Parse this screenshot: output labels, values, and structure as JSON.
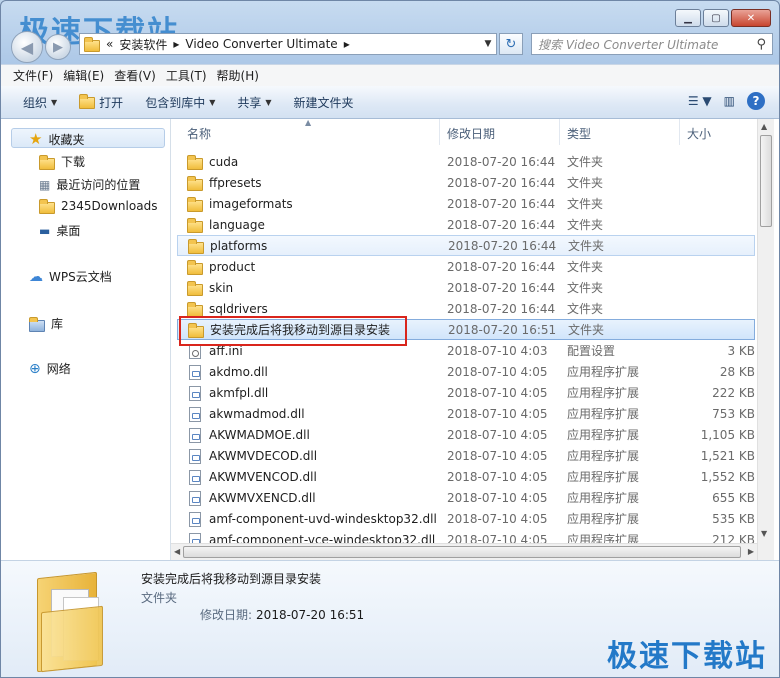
{
  "watermark": "极速下载站",
  "address": {
    "segments": [
      "«",
      "安装软件",
      "Video Converter Ultimate"
    ],
    "sep": "▸"
  },
  "search": {
    "placeholder": "搜索 Video Converter Ultimate"
  },
  "menubar": [
    "文件(F)",
    "编辑(E)",
    "查看(V)",
    "工具(T)",
    "帮助(H)"
  ],
  "toolbar": {
    "organize": "组织",
    "open": "打开",
    "include_library": "包含到库中",
    "share": "共享",
    "new_folder": "新建文件夹"
  },
  "nav": {
    "favorites": "收藏夹",
    "downloads": "下载",
    "recent": "最近访问的位置",
    "d2345": "2345Downloads",
    "desktop": "桌面",
    "wps": "WPS云文档",
    "library": "库",
    "network": "网络"
  },
  "columns": {
    "name": "名称",
    "date": "修改日期",
    "type": "类型",
    "size": "大小"
  },
  "files": [
    {
      "name": "cuda",
      "date": "2018-07-20 16:44",
      "type": "文件夹",
      "size": "",
      "kind": "folder"
    },
    {
      "name": "ffpresets",
      "date": "2018-07-20 16:44",
      "type": "文件夹",
      "size": "",
      "kind": "folder"
    },
    {
      "name": "imageformats",
      "date": "2018-07-20 16:44",
      "type": "文件夹",
      "size": "",
      "kind": "folder"
    },
    {
      "name": "language",
      "date": "2018-07-20 16:44",
      "type": "文件夹",
      "size": "",
      "kind": "folder"
    },
    {
      "name": "platforms",
      "date": "2018-07-20 16:44",
      "type": "文件夹",
      "size": "",
      "kind": "folder",
      "state": "hover"
    },
    {
      "name": "product",
      "date": "2018-07-20 16:44",
      "type": "文件夹",
      "size": "",
      "kind": "folder"
    },
    {
      "name": "skin",
      "date": "2018-07-20 16:44",
      "type": "文件夹",
      "size": "",
      "kind": "folder"
    },
    {
      "name": "sqldrivers",
      "date": "2018-07-20 16:44",
      "type": "文件夹",
      "size": "",
      "kind": "folder"
    },
    {
      "name": "安装完成后将我移动到源目录安装",
      "date": "2018-07-20 16:51",
      "type": "文件夹",
      "size": "",
      "kind": "folder",
      "state": "selected"
    },
    {
      "name": "aff.ini",
      "date": "2018-07-10 4:03",
      "type": "配置设置",
      "size": "3 KB",
      "kind": "ini"
    },
    {
      "name": "akdmo.dll",
      "date": "2018-07-10 4:05",
      "type": "应用程序扩展",
      "size": "28 KB",
      "kind": "dll"
    },
    {
      "name": "akmfpl.dll",
      "date": "2018-07-10 4:05",
      "type": "应用程序扩展",
      "size": "222 KB",
      "kind": "dll"
    },
    {
      "name": "akwmadmod.dll",
      "date": "2018-07-10 4:05",
      "type": "应用程序扩展",
      "size": "753 KB",
      "kind": "dll"
    },
    {
      "name": "AKWMADMOE.dll",
      "date": "2018-07-10 4:05",
      "type": "应用程序扩展",
      "size": "1,105 KB",
      "kind": "dll"
    },
    {
      "name": "AKWMVDECOD.dll",
      "date": "2018-07-10 4:05",
      "type": "应用程序扩展",
      "size": "1,521 KB",
      "kind": "dll"
    },
    {
      "name": "AKWMVENCOD.dll",
      "date": "2018-07-10 4:05",
      "type": "应用程序扩展",
      "size": "1,552 KB",
      "kind": "dll"
    },
    {
      "name": "AKWMVXENCD.dll",
      "date": "2018-07-10 4:05",
      "type": "应用程序扩展",
      "size": "655 KB",
      "kind": "dll"
    },
    {
      "name": "amf-component-uvd-windesktop32.dll",
      "date": "2018-07-10 4:05",
      "type": "应用程序扩展",
      "size": "535 KB",
      "kind": "dll"
    },
    {
      "name": "amf-component-vce-windesktop32.dll",
      "date": "2018-07-10 4:05",
      "type": "应用程序扩展",
      "size": "212 KB",
      "kind": "dll"
    }
  ],
  "details": {
    "name": "安装完成后将我移动到源目录安装",
    "type": "文件夹",
    "date_label": "修改日期:",
    "date_value": "2018-07-20 16:51"
  },
  "colors": {
    "accent": "#3399ff",
    "highlight_box": "#d9251c",
    "watermark": "#1d77c7"
  }
}
